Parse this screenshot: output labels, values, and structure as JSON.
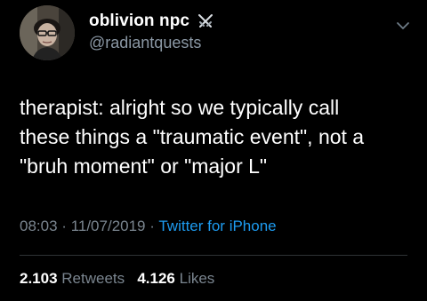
{
  "author": {
    "display_name": "oblivion npc",
    "name_emoji_icon": "crossed-swords-icon",
    "handle": "@radiantquests",
    "avatar": "profile-photo"
  },
  "tweet": {
    "text": "therapist: alright so we typically call\nthese things a \"traumatic event\", not a\n\"bruh moment\" or \"major L\""
  },
  "meta": {
    "time": "08:03",
    "separator": "·",
    "date": "11/07/2019",
    "source": "Twitter for iPhone"
  },
  "stats": {
    "retweets_count": "2.103",
    "retweets_label": "Retweets",
    "likes_count": "4.126",
    "likes_label": "Likes"
  },
  "colors": {
    "background": "#000000",
    "text": "#ffffff",
    "secondary_text": "#8b98a5",
    "link": "#1d9bf0"
  }
}
